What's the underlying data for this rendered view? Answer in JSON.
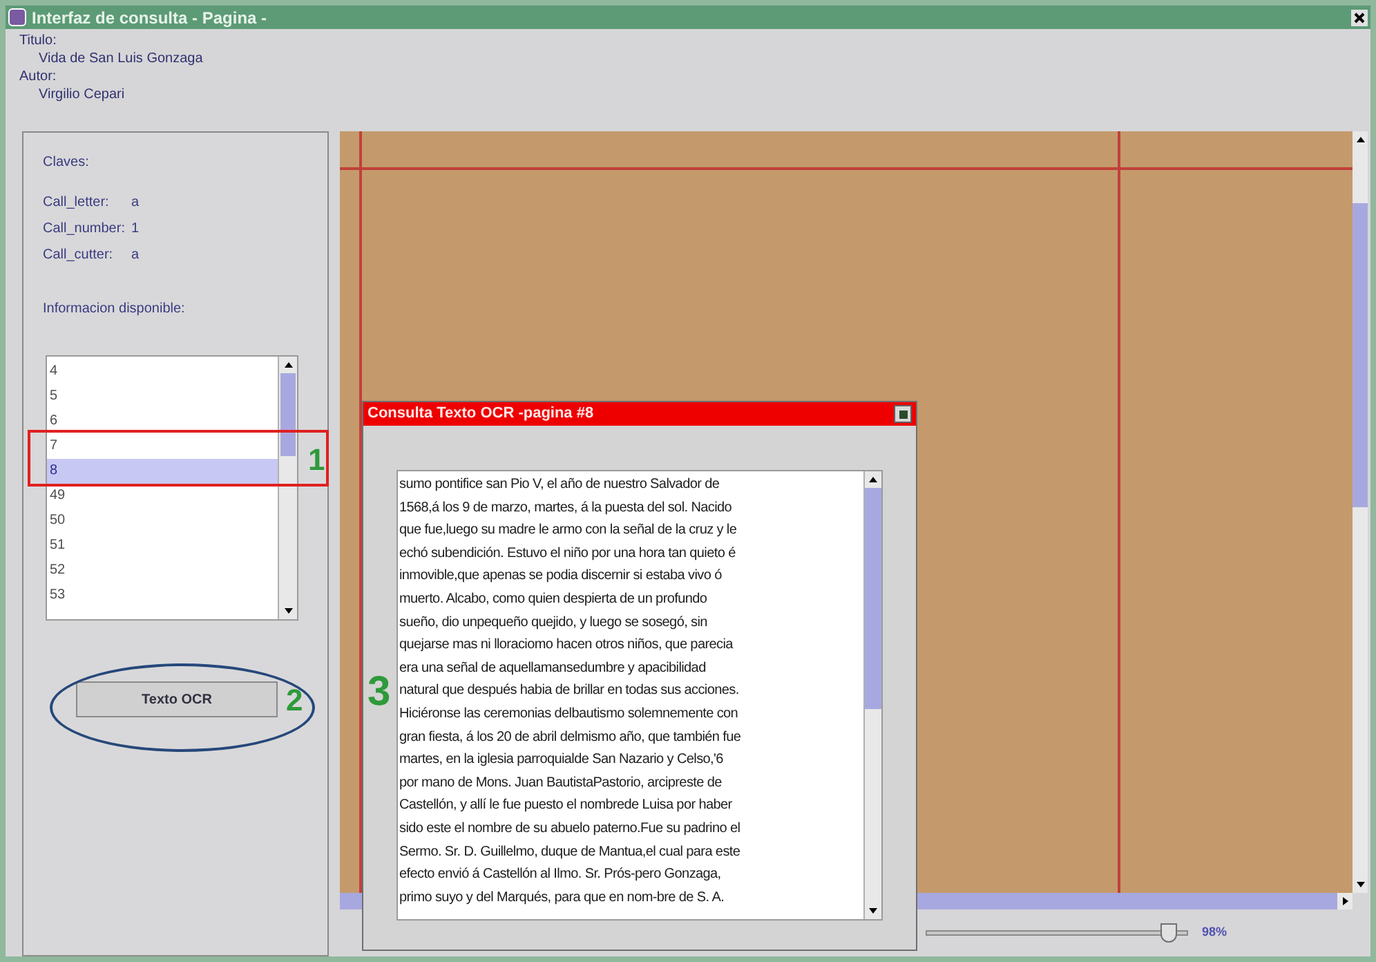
{
  "window": {
    "title": "Interfaz de consulta - Pagina -"
  },
  "header": [
    {
      "label": "Titulo:",
      "value": "Vida de San Luis Gonzaga"
    },
    {
      "label": "Autor:",
      "value": "Virgilio Cepari"
    }
  ],
  "sidebar": {
    "title": "Claves:",
    "keys": [
      {
        "label": "Call_letter:",
        "value": "a"
      },
      {
        "label": "Call_number:",
        "value": "1"
      },
      {
        "label": "Call_cutter:",
        "value": "a"
      }
    ],
    "list_title": "Informacion disponible:",
    "pages": [
      {
        "label": "4",
        "selected": false
      },
      {
        "label": "5",
        "selected": false
      },
      {
        "label": "6",
        "selected": false
      },
      {
        "label": "7",
        "selected": false
      },
      {
        "label": "8",
        "selected": true
      },
      {
        "label": "49",
        "selected": false
      },
      {
        "label": "50",
        "selected": false
      },
      {
        "label": "51",
        "selected": false
      },
      {
        "label": "52",
        "selected": false
      },
      {
        "label": "53",
        "selected": false
      }
    ],
    "button": "Texto OCR"
  },
  "zoom": {
    "level": 0.96,
    "reading": "98%"
  },
  "dialog": {
    "title": "Consulta Texto OCR -pagina #8",
    "lines": [
      "sumo pontifice san Pio V, el año de nuestro Salvador de",
      "1568,á los 9 de marzo, martes, á la puesta del sol. Nacido",
      "que fue,luego su madre le armo con la señal de la cruz y le",
      "echó subendición. Estuvo el niño por una hora tan quieto é",
      "inmovible,que  apenas se podia discernir si estaba vivo ó",
      "muerto. Alcabo, como quien despierta de un profundo",
      "sueño, dio unpequeño quejido, y luego se sosegó, sin",
      "quejarse mas ni lloraciomo hacen otros niños, que parecia",
      "era una señal de aquellamansedumbre y apacibilidad",
      "natural que después habia de brillar en todas sus acciones.",
      "Hiciéronse las ceremonias delbautismo solemnemente con",
      "gran fiesta, á los 20 de abril delmismo año, que también fue",
      "martes, en la iglesia parroquialde San Nazario y Celso,'6",
      "por mano de Mons. Juan BautistaPastorio, arcipreste de",
      "Castellón, y allí le fue puesto el nombrede Luisa por haber",
      "sido este el nombre de su abuelo paterno.Fue su padrino el",
      "Sermo. Sr. D. Guillelmo, duque de Mantua,el cual para este",
      "efecto envió á Castellón al Ilmo. Sr. Prós-pero Gonzaga,",
      "primo suyo y del Marqués, para que en nom-bre de S. A."
    ]
  },
  "annotations": [
    {
      "kind": "box",
      "label": "1"
    },
    {
      "kind": "ellipse",
      "label": "2"
    },
    {
      "kind": "plain",
      "label": "3"
    }
  ]
}
